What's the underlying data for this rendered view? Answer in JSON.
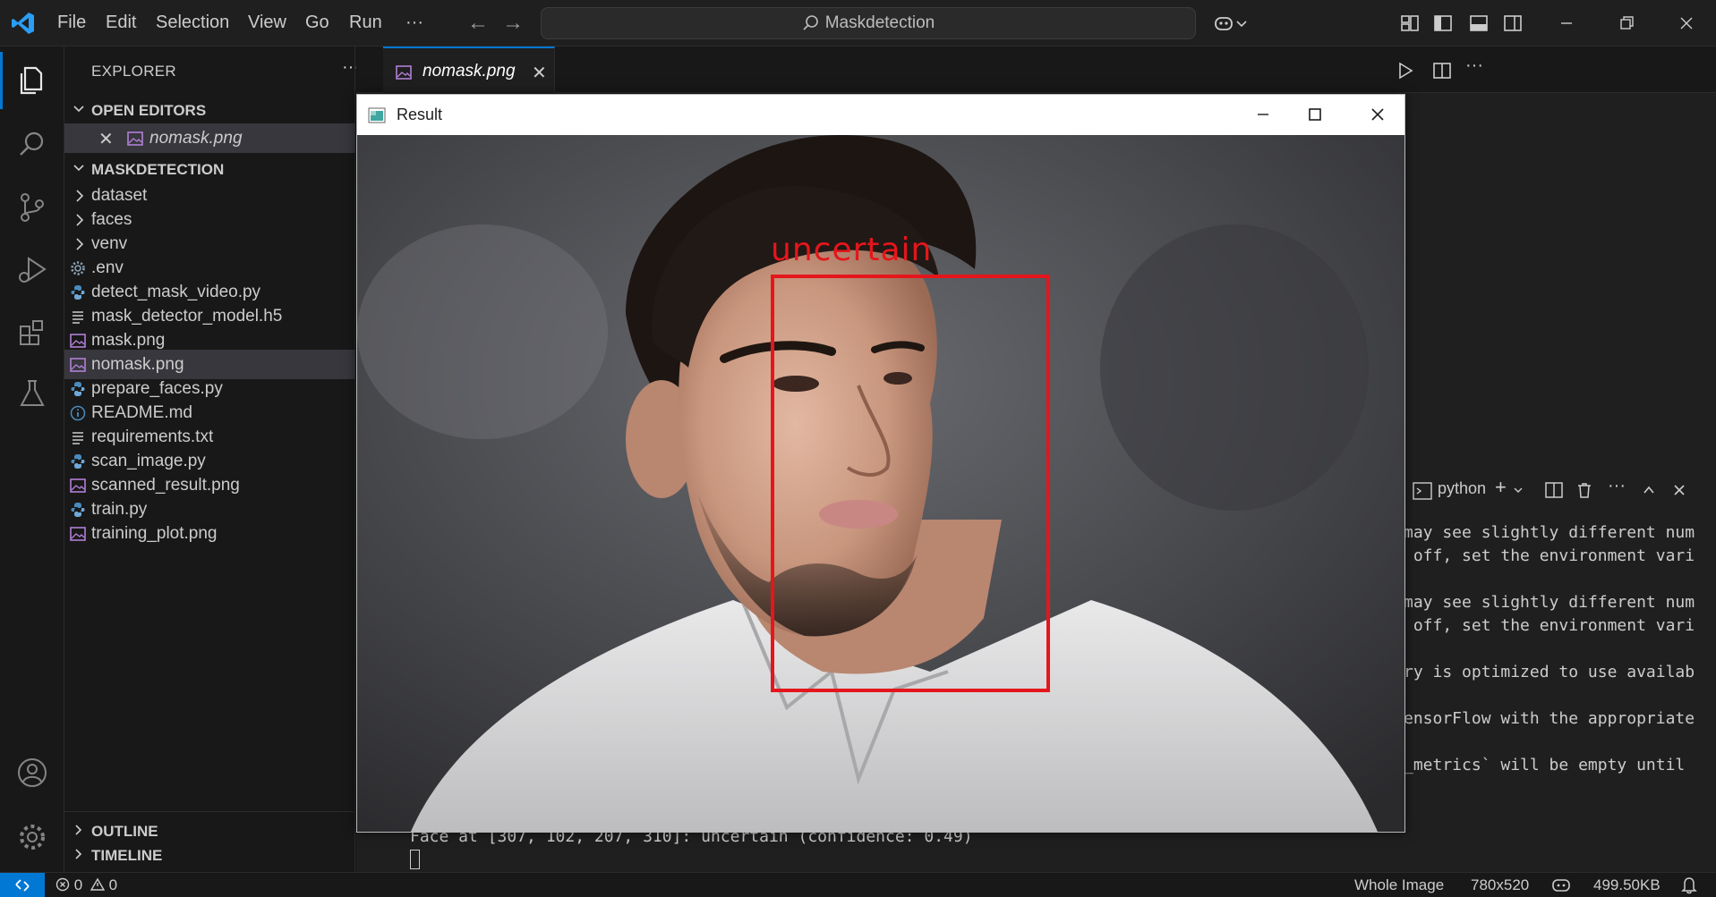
{
  "menu": [
    "File",
    "Edit",
    "Selection",
    "View",
    "Go",
    "Run",
    "···"
  ],
  "command_center": {
    "text": "Maskdetection"
  },
  "explorer": {
    "title": "EXPLORER",
    "more": "···",
    "open_editors_header": "OPEN EDITORS",
    "open_editors": [
      {
        "label": "nomask.png",
        "close": "✕"
      }
    ],
    "project_header": "MASKDETECTION",
    "items": [
      {
        "label": "dataset",
        "kind": "folder"
      },
      {
        "label": "faces",
        "kind": "folder"
      },
      {
        "label": "venv",
        "kind": "folder"
      },
      {
        "label": ".env",
        "kind": "settings"
      },
      {
        "label": "detect_mask_video.py",
        "kind": "python"
      },
      {
        "label": "mask_detector_model.h5",
        "kind": "text"
      },
      {
        "label": "mask.png",
        "kind": "image"
      },
      {
        "label": "nomask.png",
        "kind": "image",
        "selected": true
      },
      {
        "label": "prepare_faces.py",
        "kind": "python"
      },
      {
        "label": "README.md",
        "kind": "info"
      },
      {
        "label": "requirements.txt",
        "kind": "text"
      },
      {
        "label": "scan_image.py",
        "kind": "python"
      },
      {
        "label": "scanned_result.png",
        "kind": "image"
      },
      {
        "label": "train.py",
        "kind": "python"
      },
      {
        "label": "training_plot.png",
        "kind": "image"
      }
    ],
    "outline_header": "OUTLINE",
    "timeline_header": "TIMELINE"
  },
  "editor": {
    "tab": {
      "label": "nomask.png",
      "close": "✕"
    }
  },
  "terminal": {
    "shell_label": "python",
    "lines": [
      "may see slightly different num",
      " off, set the environment vari",
      "",
      "may see slightly different num",
      " off, set the environment vari",
      "",
      "ry is optimized to use availab",
      "",
      "ensorFlow with the appropriate",
      "",
      "_metrics` will be empty until"
    ],
    "output_line": "Face at [307, 102, 207, 310]: uncertain (confidence: 0.49)"
  },
  "result_window": {
    "title": "Result",
    "detection_label": "uncertain"
  },
  "statusbar": {
    "errors": "0",
    "warnings": "0",
    "zoom_mode": "Whole Image",
    "dimensions": "780x520",
    "file_size": "499.50KB"
  },
  "colors": {
    "accent": "#0078d4",
    "detection": "#e5161b",
    "image_icon": "#b180d7",
    "python_icon": "#4b8bbe"
  }
}
